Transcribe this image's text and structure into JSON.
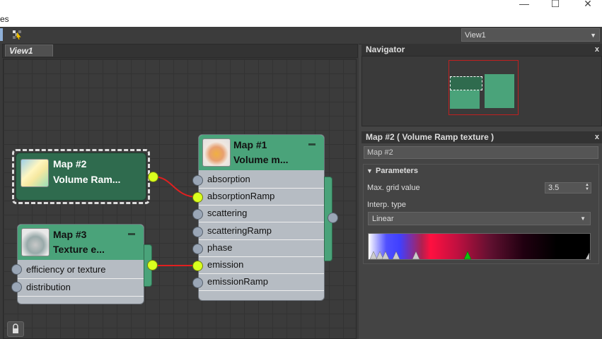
{
  "window": {
    "title_fragment": "es",
    "minimize": "—",
    "maximize": "☐",
    "close": "✕"
  },
  "toolbar": {
    "pick_icon": "pick-checker-icon",
    "view_selector": "View1",
    "view_arrow": "▼"
  },
  "view_panel": {
    "tab_label": "View1"
  },
  "nodes": {
    "map2": {
      "line1": "Map #2",
      "line2": "Volume  Ram..."
    },
    "map3": {
      "line1": "Map #3",
      "line2": "Texture  e...",
      "slots": [
        "efficiency or texture",
        "distribution"
      ]
    },
    "map1": {
      "line1": "Map #1",
      "line2": "Volume  m...",
      "slots": [
        "absorption",
        "absorptionRamp",
        "scattering",
        "scatteringRamp",
        "phase",
        "emission",
        "emissionRamp"
      ]
    }
  },
  "navigator": {
    "title": "Navigator",
    "close": "x"
  },
  "map_panel": {
    "title": "Map #2  ( Volume Ramp texture )",
    "close": "x",
    "name_field": "Map #2",
    "section": "Parameters",
    "section_arrow": "▼",
    "grid_label": "Max. grid value",
    "grid_value": "3.5",
    "spinner": "▲▼",
    "interp_label": "Interp. type",
    "interp_value": "Linear",
    "interp_arrow": "▼"
  },
  "colors": {
    "node_header": "#4aa37a",
    "node_header_selected": "#2f6b4e",
    "socket_connected": "#d9ff1e",
    "wire": "#e02020",
    "navigator_frame": "#c02020"
  }
}
